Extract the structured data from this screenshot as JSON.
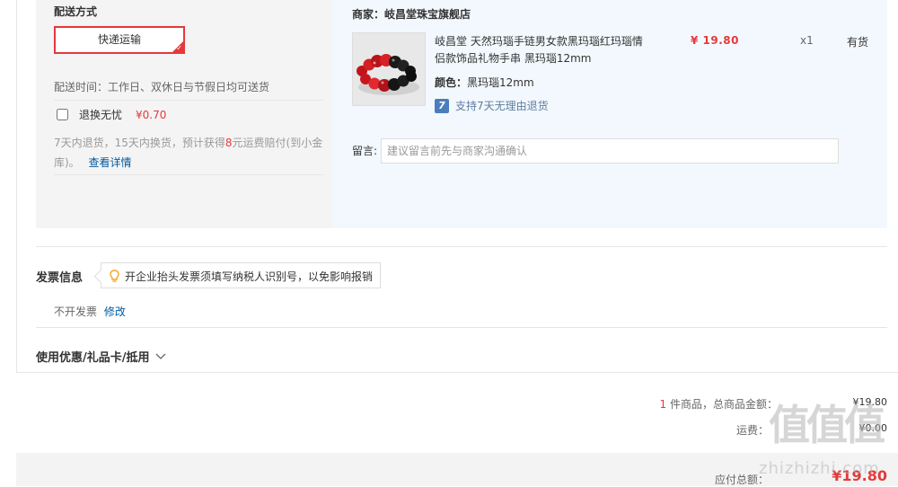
{
  "shipping": {
    "title": "配送方式",
    "method_button": "快递运输",
    "delivery_time": "配送时间：工作日、双休日与节假日均可送货",
    "worry_free_label": "退换无忧",
    "worry_free_price": "¥0.70",
    "desc_a": "7天内退货，15天内换货，预计获得",
    "desc_num": "8",
    "desc_b": "元运费赔付(到小金",
    "desc_c": "库)。",
    "details_link": "查看详情"
  },
  "merchant": {
    "label": "商家：岐昌堂珠宝旗舰店",
    "product": {
      "name_line1": "岐昌堂 天然玛瑙手链男女款黑玛瑙红玛瑙情",
      "name_line2": "侣款饰品礼物手串 黑玛瑙12mm",
      "color_label": "颜色：",
      "color_value": "黑玛瑙12mm",
      "return_badge_icon": "7",
      "return_policy": "支持7天无理由退货",
      "price": "¥ 19.80",
      "quantity": "x1",
      "stock": "有货"
    },
    "note_label": "留言:",
    "note_placeholder": "建议留言前先与商家沟通确认"
  },
  "invoice": {
    "title": "发票信息",
    "tip": "开企业抬头发票须填写纳税人识别号，以免影响报销",
    "status": "不开发票",
    "modify_link": "修改"
  },
  "discounts": {
    "title": "使用优惠/礼品卡/抵用"
  },
  "summary": {
    "count": "1",
    "count_label": " 件商品，总商品金额：",
    "goods_amount": "¥19.80",
    "freight_label": "运费：",
    "freight_amount": "¥0.00",
    "payable_label": "应付总额：",
    "payable_amount": "¥19.80"
  },
  "watermark": {
    "logo": "值值值",
    "url": "zhizhizhi.com"
  },
  "colors": {
    "accent": "#e4393c",
    "link": "#005aa0",
    "panel_blue": "#f3f8fe",
    "panel_gray": "#f4f4f4"
  }
}
